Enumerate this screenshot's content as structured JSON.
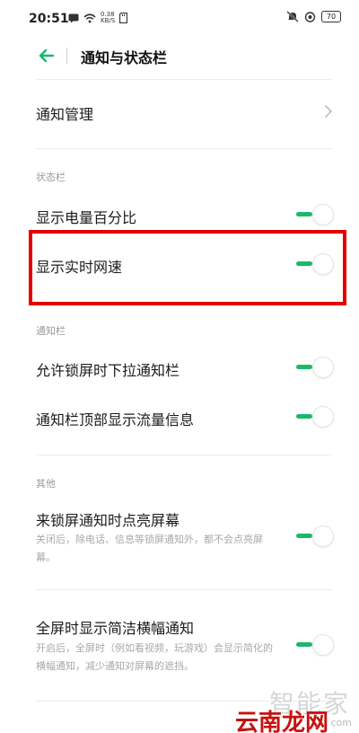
{
  "status_bar": {
    "time": "20:51",
    "net_speed_value": "0.38",
    "net_speed_unit": "KB/S",
    "battery": "70"
  },
  "header": {
    "title": "通知与状态栏"
  },
  "rows": {
    "notification_manage": "通知管理",
    "battery_percent": "显示电量百分比",
    "realtime_speed": "显示实时网速",
    "lockscreen_pulldown": "允许锁屏时下拉通知栏",
    "traffic_info": "通知栏顶部显示流量信息",
    "wake_screen": "来锁屏通知时点亮屏幕",
    "wake_screen_desc": "关闭后，除电话、信息等锁屏通知外，都不会点亮屏幕。",
    "fullscreen_banner": "全屏时显示简洁横幅通知",
    "fullscreen_banner_desc": "开启后，全屏时（例如看视频，玩游戏）会显示简化的横幅通知，减少通知对屏幕的遮挡。"
  },
  "sections": {
    "status_bar": "状态栏",
    "notification_bar": "通知栏",
    "other": "其他"
  },
  "toggles": {
    "battery_percent": true,
    "realtime_speed": true,
    "lockscreen_pulldown": true,
    "traffic_info": true,
    "wake_screen": true,
    "fullscreen_banner": true
  },
  "watermark": {
    "top": "智能家",
    "bottom": "云南龙网",
    "url": "com"
  },
  "colors": {
    "accent": "#19b96b",
    "highlight": "#e40000"
  }
}
